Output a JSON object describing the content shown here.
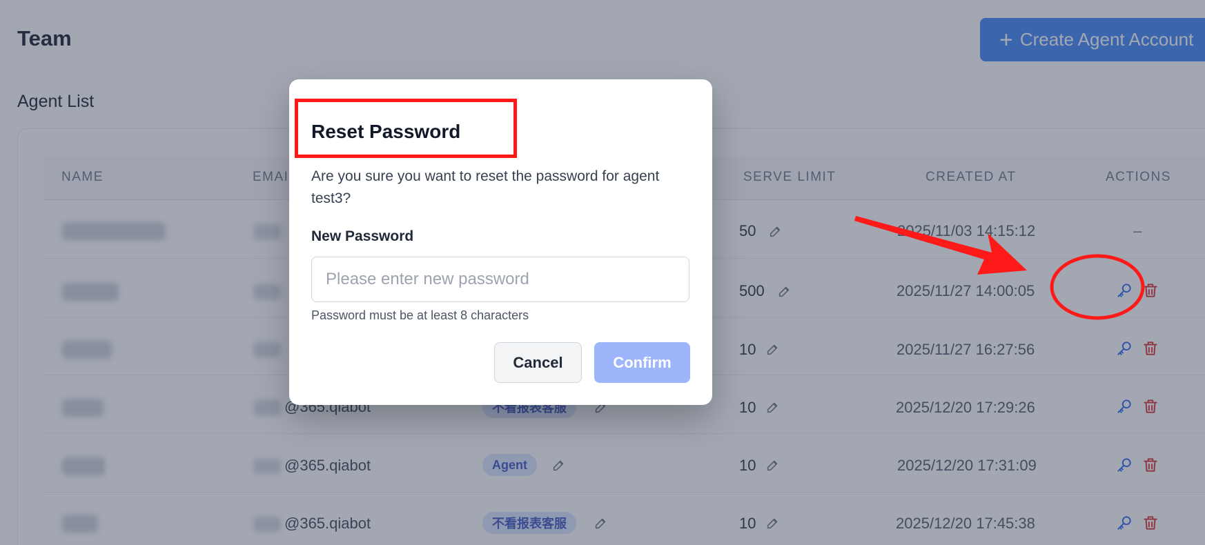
{
  "page": {
    "title": "Team",
    "create_button": "Create Agent Account",
    "section_title": "Agent List"
  },
  "table": {
    "headers": [
      "NAME",
      "EMAI",
      "SERVE LIMIT",
      "CREATED AT",
      "ACTIONS"
    ],
    "rows": [
      {
        "email": "",
        "role": "",
        "serve_limit": "50",
        "created_at": "2025/11/03 14:15:12",
        "actions": "–"
      },
      {
        "email": "",
        "role": "",
        "serve_limit": "500",
        "created_at": "2025/11/27 14:00:05",
        "actions": ""
      },
      {
        "email": "",
        "role": "",
        "serve_limit": "10",
        "created_at": "2025/11/27 16:27:56",
        "actions": ""
      },
      {
        "email": "@365.qiabot",
        "role": "不看报表客服",
        "serve_limit": "10",
        "created_at": "2025/12/20 17:29:26",
        "actions": ""
      },
      {
        "email": "@365.qiabot",
        "role": "Agent",
        "serve_limit": "10",
        "created_at": "2025/12/20 17:31:09",
        "actions": ""
      },
      {
        "email": "@365.qiabot",
        "role": "不看报表客服",
        "serve_limit": "10",
        "created_at": "2025/12/20 17:45:38",
        "actions": ""
      }
    ]
  },
  "modal": {
    "title": "Reset Password",
    "message": "Are you sure you want to reset the password for agent test3?",
    "field_label": "New Password",
    "placeholder": "Please enter new password",
    "hint": "Password must be at least 8 characters",
    "cancel": "Cancel",
    "confirm": "Confirm"
  },
  "colors": {
    "primary": "#3b82f6",
    "confirm_disabled": "#9db5fb",
    "delete_icon": "#dc2626",
    "annotation": "#ff1a1a"
  }
}
